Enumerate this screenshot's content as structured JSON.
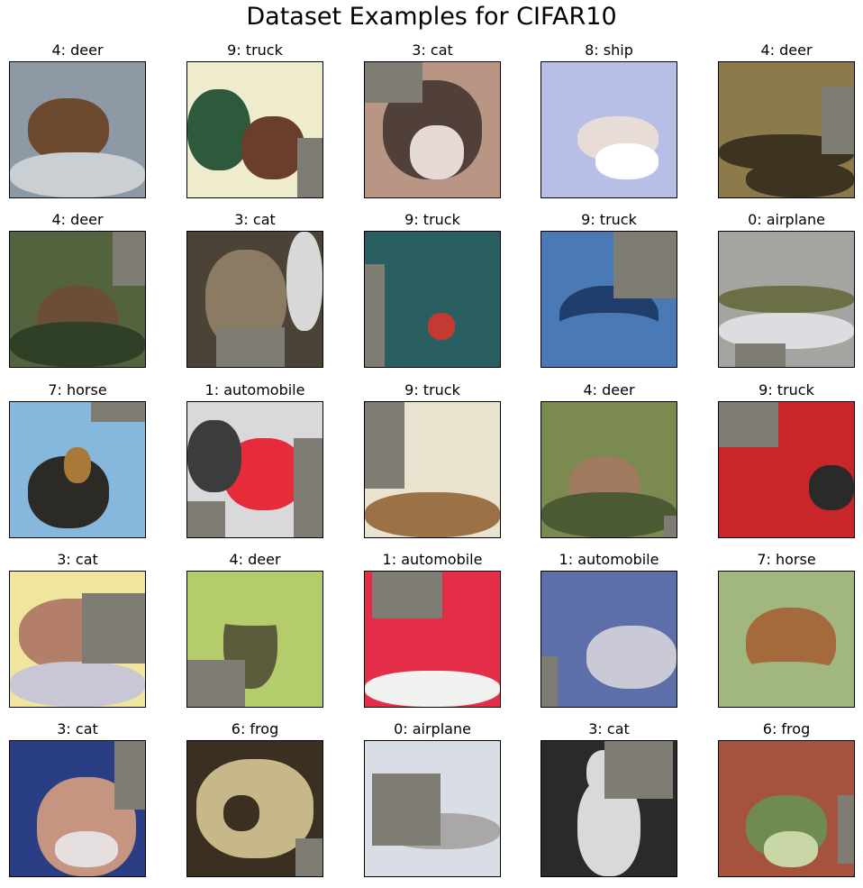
{
  "figure": {
    "title": "Dataset Examples for CIFAR10"
  },
  "patch_color": "#7f7c74",
  "samples": [
    {
      "label": "4: deer",
      "class_index": 4,
      "class_name": "deer",
      "palette": [
        "#8d9aa6",
        "#6b4a30",
        "#c9cfd2"
      ]
    },
    {
      "label": "9: truck",
      "class_index": 9,
      "class_name": "truck",
      "palette": [
        "#efeccd",
        "#2d5a3c",
        "#6a3e2a"
      ]
    },
    {
      "label": "3: cat",
      "class_index": 3,
      "class_name": "cat",
      "palette": [
        "#b99684",
        "#51403a",
        "#e5dad5"
      ]
    },
    {
      "label": "8: ship",
      "class_index": 8,
      "class_name": "ship",
      "palette": [
        "#b8bfe6",
        "#e8dcd7",
        "#ffffff"
      ]
    },
    {
      "label": "4: deer",
      "class_index": 4,
      "class_name": "deer",
      "palette": [
        "#8d7a4a",
        "#d8c7a5",
        "#3c3420"
      ]
    },
    {
      "label": "4: deer",
      "class_index": 4,
      "class_name": "deer",
      "palette": [
        "#52633e",
        "#6a4f36",
        "#2f4027"
      ]
    },
    {
      "label": "3: cat",
      "class_index": 3,
      "class_name": "cat",
      "palette": [
        "#4b4336",
        "#8b7b63",
        "#d8d8d8"
      ]
    },
    {
      "label": "9: truck",
      "class_index": 9,
      "class_name": "truck",
      "palette": [
        "#2a5f62",
        "#c23b33",
        "#7fb4d2"
      ]
    },
    {
      "label": "9: truck",
      "class_index": 9,
      "class_name": "truck",
      "palette": [
        "#4a7ab6",
        "#1f3e6c",
        "#d2c9b2"
      ]
    },
    {
      "label": "0: airplane",
      "class_index": 0,
      "class_name": "airplane",
      "palette": [
        "#a4a5a0",
        "#6c6f45",
        "#dcdde0"
      ]
    },
    {
      "label": "7: horse",
      "class_index": 7,
      "class_name": "horse",
      "palette": [
        "#86b7dc",
        "#2c2a24",
        "#a87a3a"
      ]
    },
    {
      "label": "1: automobile",
      "class_index": 1,
      "class_name": "automobile",
      "palette": [
        "#d9d9db",
        "#e62b3a",
        "#3b3d3d"
      ]
    },
    {
      "label": "9: truck",
      "class_index": 9,
      "class_name": "truck",
      "palette": [
        "#e8e2cf",
        "#9b7246",
        "#4a4d4a"
      ]
    },
    {
      "label": "4: deer",
      "class_index": 4,
      "class_name": "deer",
      "palette": [
        "#7b8a4f",
        "#a07a5f",
        "#4b5a32"
      ]
    },
    {
      "label": "9: truck",
      "class_index": 9,
      "class_name": "truck",
      "palette": [
        "#c8262b",
        "#eeeeee",
        "#2a2a2a"
      ]
    },
    {
      "label": "3: cat",
      "class_index": 3,
      "class_name": "cat",
      "palette": [
        "#efe59d",
        "#b47f6a",
        "#c9c7d6"
      ]
    },
    {
      "label": "4: deer",
      "class_index": 4,
      "class_name": "deer",
      "palette": [
        "#b4cc6b",
        "#5b5c3b",
        "#e8e6c2"
      ]
    },
    {
      "label": "1: automobile",
      "class_index": 1,
      "class_name": "automobile",
      "palette": [
        "#e42d48",
        "#3a3d3a",
        "#f1f1ef"
      ]
    },
    {
      "label": "1: automobile",
      "class_index": 1,
      "class_name": "automobile",
      "palette": [
        "#5c6fa8",
        "#c9cad6",
        "#1f2a55"
      ]
    },
    {
      "label": "7: horse",
      "class_index": 7,
      "class_name": "horse",
      "palette": [
        "#a2b780",
        "#a46a3b",
        "#434334"
      ]
    },
    {
      "label": "3: cat",
      "class_index": 3,
      "class_name": "cat",
      "palette": [
        "#2a3e84",
        "#c59582",
        "#e5e0df"
      ]
    },
    {
      "label": "6: frog",
      "class_index": 6,
      "class_name": "frog",
      "palette": [
        "#3b2f22",
        "#c7b88a",
        "#8a7a52"
      ]
    },
    {
      "label": "0: airplane",
      "class_index": 0,
      "class_name": "airplane",
      "palette": [
        "#d9dde6",
        "#a9a8a6",
        "#7f7e78"
      ]
    },
    {
      "label": "3: cat",
      "class_index": 3,
      "class_name": "cat",
      "palette": [
        "#2a2a2a",
        "#d9d9d9",
        "#8a8a8a"
      ]
    },
    {
      "label": "6: frog",
      "class_index": 6,
      "class_name": "frog",
      "palette": [
        "#a5523e",
        "#6f8a52",
        "#c9d6a5"
      ]
    }
  ]
}
